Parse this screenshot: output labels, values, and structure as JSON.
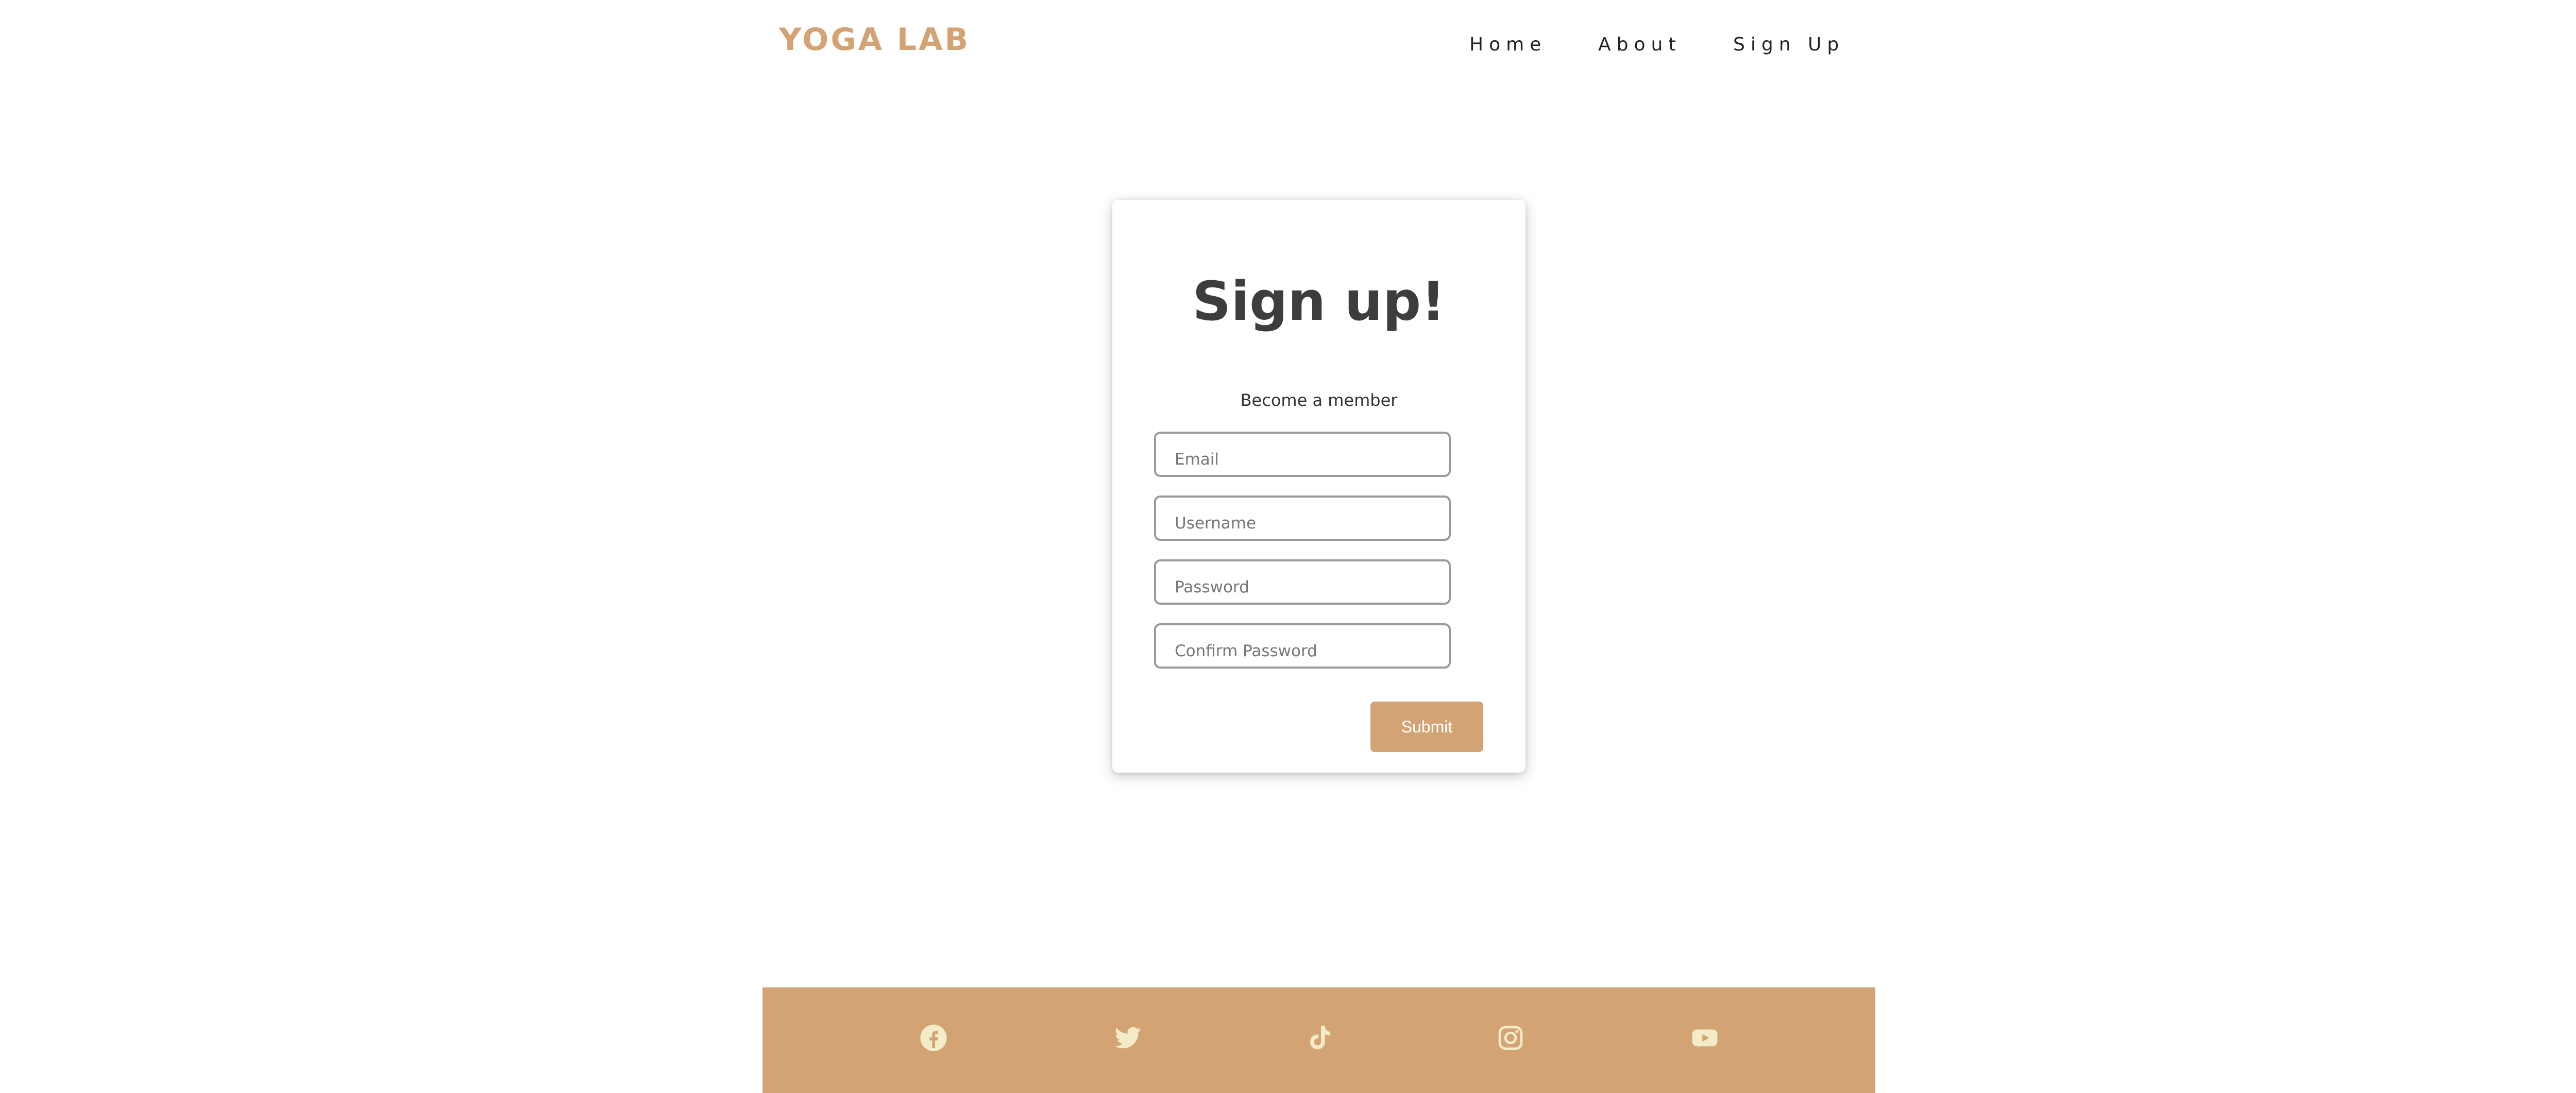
{
  "header": {
    "logo": "YOGA LAB",
    "nav": {
      "home": "Home",
      "about": "About",
      "signup": "Sign Up"
    }
  },
  "form": {
    "title": "Sign up!",
    "subtitle": "Become a member",
    "fields": {
      "email_placeholder": "Email",
      "username_placeholder": "Username",
      "password_placeholder": "Password",
      "confirm_placeholder": "Confirm Password"
    },
    "submit_label": "Submit"
  },
  "footer": {
    "social_icons": [
      "facebook-icon",
      "twitter-icon",
      "tiktok-icon",
      "instagram-icon",
      "youtube-icon"
    ]
  },
  "colors": {
    "brand": "#d4a373",
    "icon": "#f3ecc8",
    "text": "#3d3d3d"
  }
}
